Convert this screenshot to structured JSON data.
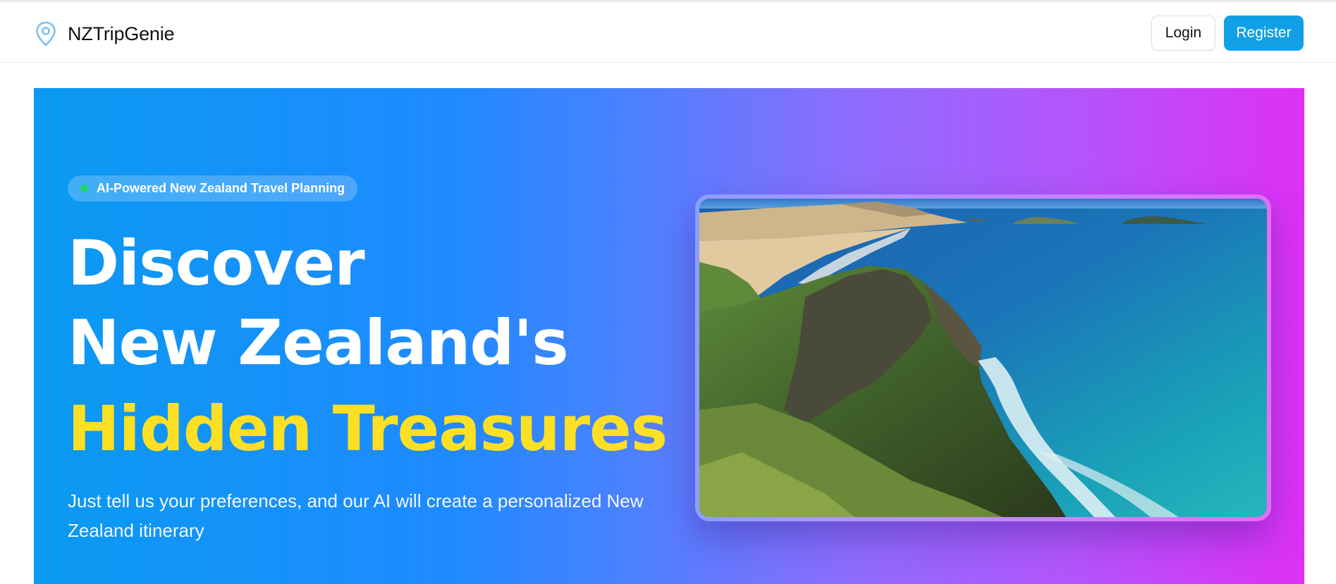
{
  "app": {
    "brand_name": "NZTripGenie",
    "brand_icon": "map-pin-icon"
  },
  "nav": {
    "login_label": "Login",
    "register_label": "Register"
  },
  "hero": {
    "badge_text": "AI-Powered New Zealand Travel Planning",
    "headline_line1": "Discover",
    "headline_line2": "New Zealand's",
    "headline_line3": "Hidden Treasures",
    "subtitle": "Just tell us your preferences, and our AI will create a personalized New Zealand itinerary",
    "image_subject": "coastal-cliffs-photo"
  },
  "colors": {
    "accent": "#11a0e6",
    "highlight": "#fde023",
    "badge_dot": "#22d36c",
    "gradient_start": "#0a9af1",
    "gradient_end": "#de30f6"
  }
}
